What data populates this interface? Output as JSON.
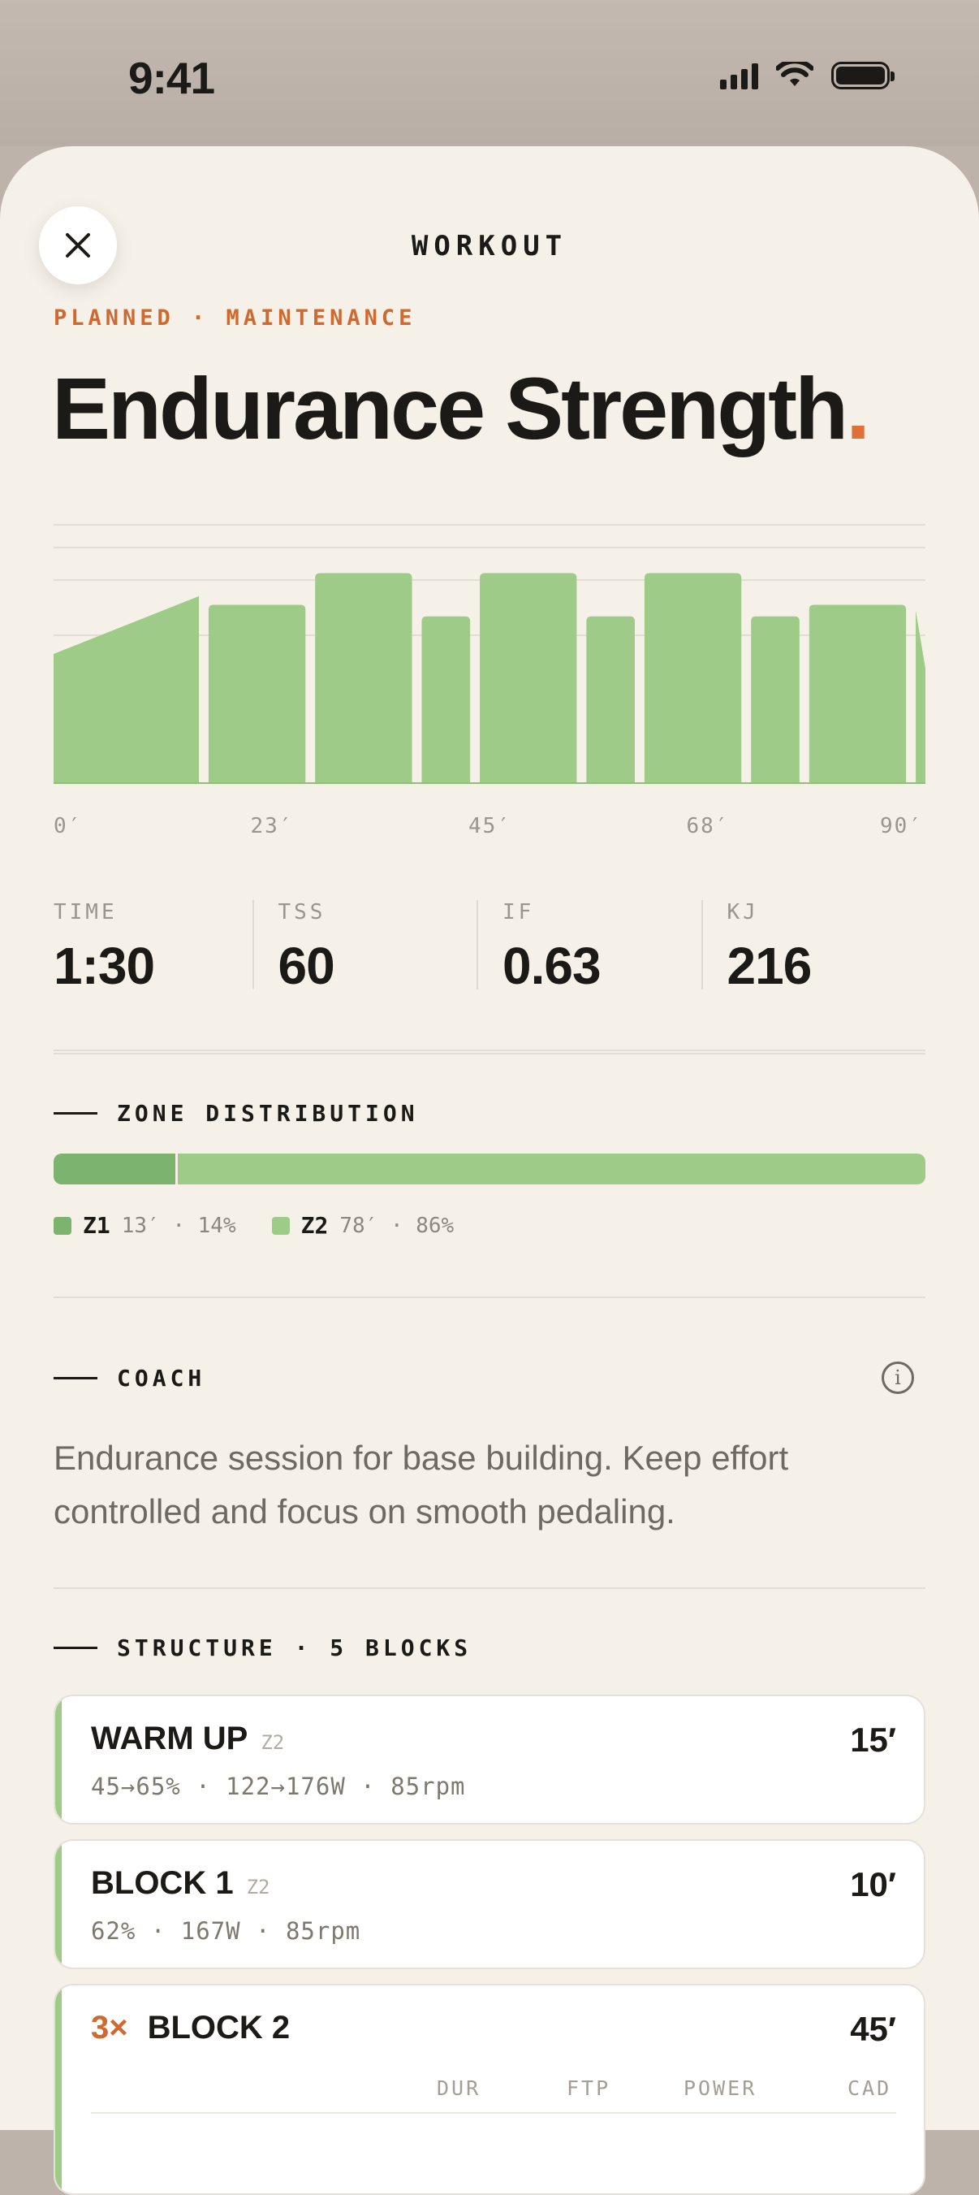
{
  "status": {
    "time": "9:41"
  },
  "header": {
    "title": "WORKOUT"
  },
  "workout": {
    "eyebrow": "PLANNED · MAINTENANCE",
    "title": "Endurance Strength",
    "title_dot": "."
  },
  "chart_data": {
    "type": "area",
    "x_ticks": [
      "0′",
      "23′",
      "45′",
      "68′",
      "90′"
    ],
    "xlim": [
      0,
      90
    ],
    "grid": true,
    "color": "#9fcb88",
    "segments": [
      {
        "start": 0,
        "end": 15,
        "from": 45,
        "to": 65
      },
      {
        "start": 16,
        "end": 26,
        "from": 62,
        "to": 62
      },
      {
        "start": 27,
        "end": 37,
        "from": 73,
        "to": 73
      },
      {
        "start": 38,
        "end": 43,
        "from": 58,
        "to": 58
      },
      {
        "start": 44,
        "end": 54,
        "from": 73,
        "to": 73
      },
      {
        "start": 55,
        "end": 60,
        "from": 58,
        "to": 58
      },
      {
        "start": 61,
        "end": 71,
        "from": 73,
        "to": 73
      },
      {
        "start": 72,
        "end": 77,
        "from": 58,
        "to": 58
      },
      {
        "start": 78,
        "end": 88,
        "from": 62,
        "to": 62
      },
      {
        "start": 89,
        "end": 101,
        "from": 60,
        "to": 40
      }
    ],
    "ylim": [
      0,
      90
    ]
  },
  "stats": [
    {
      "label": "TIME",
      "value": "1:30"
    },
    {
      "label": "TSS",
      "value": "60"
    },
    {
      "label": "IF",
      "value": "0.63"
    },
    {
      "label": "KJ",
      "value": "216"
    }
  ],
  "zones": {
    "title": "ZONE DISTRIBUTION",
    "items": [
      {
        "name": "Z1",
        "detail": "13′ · 14%",
        "fraction": 0.14,
        "color": "#7cb36f"
      },
      {
        "name": "Z2",
        "detail": "78′ · 86%",
        "fraction": 0.86,
        "color": "#9fcb88"
      }
    ]
  },
  "coach": {
    "title": "COACH",
    "text": "Endurance session for base building. Keep effort controlled and focus on smooth pedaling.",
    "info_icon": "info-icon"
  },
  "structure": {
    "title": "STRUCTURE · 5 BLOCKS",
    "blocks": [
      {
        "name": "WARM UP",
        "zone": "Z2",
        "duration": "15′",
        "meta": "45→65% · 122→176W · 85rpm"
      },
      {
        "name": "BLOCK 1",
        "zone": "Z2",
        "duration": "10′",
        "meta": "62% · 167W · 85rpm"
      },
      {
        "repeat": "3×",
        "name": "BLOCK 2",
        "duration": "45′",
        "columns": [
          "DUR",
          "FTP",
          "POWER",
          "CAD"
        ]
      }
    ]
  }
}
